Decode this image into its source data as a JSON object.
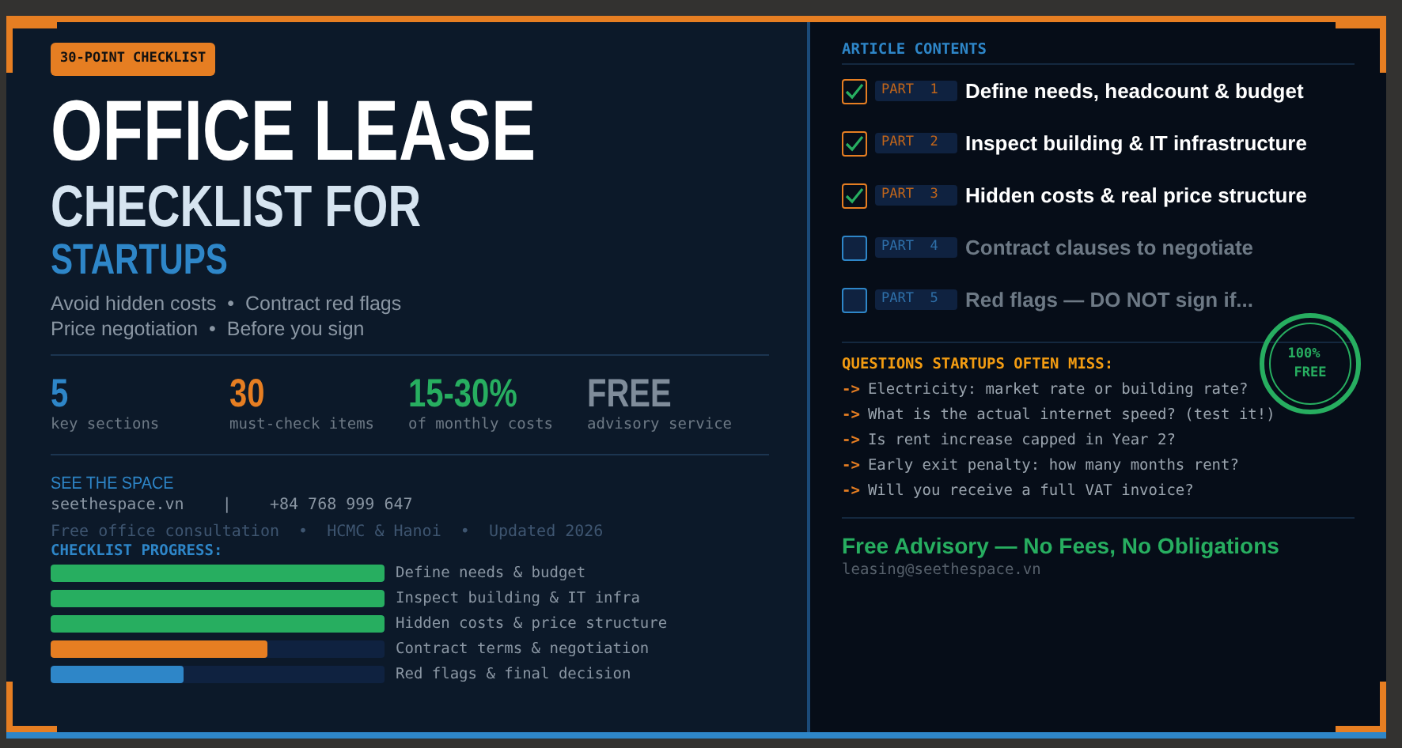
{
  "badge": "30-POINT CHECKLIST",
  "title": {
    "line1": "OFFICE LEASE",
    "line2": "CHECKLIST FOR",
    "line3": "STARTUPS"
  },
  "subtitle_lines": [
    "Avoid hidden costs  •  Contract red flags",
    "Price negotiation  •  Before you sign"
  ],
  "stats": [
    {
      "value": "5",
      "label": "key sections",
      "color": "#2e86c8"
    },
    {
      "value": "30",
      "label": "must-check items",
      "color": "#e67e22"
    },
    {
      "value": "15-30%",
      "label": "of monthly costs",
      "color": "#27ae60"
    },
    {
      "value": "FREE",
      "label": "advisory service",
      "color": "#7f8c9a"
    }
  ],
  "brand": {
    "name": "SEE THE SPACE",
    "contact": "seethespace.vn    |    +84 768 999 647",
    "note": "Free office consultation  •  HCMC & Hanoi  •  Updated 2026"
  },
  "progress": {
    "heading": "CHECKLIST PROGRESS:",
    "items": [
      {
        "label": "Define needs & budget",
        "level": 1,
        "color": "#27ae60"
      },
      {
        "label": "Inspect building & IT infra",
        "level": 1,
        "color": "#27ae60"
      },
      {
        "label": "Hidden costs & price structure",
        "level": 1,
        "color": "#27ae60"
      },
      {
        "label": "Contract terms & negotiation",
        "level": 0.65,
        "color": "#e67e22"
      },
      {
        "label": "Red flags & final decision",
        "level": 0.4,
        "color": "#2e86c8"
      }
    ]
  },
  "contents": {
    "heading": "ARTICLE CONTENTS",
    "items": [
      {
        "part": "PART 1",
        "title": "Define needs, headcount & budget",
        "checked": true
      },
      {
        "part": "PART 2",
        "title": "Inspect building & IT infrastructure",
        "checked": true
      },
      {
        "part": "PART 3",
        "title": "Hidden costs & real price structure",
        "checked": true
      },
      {
        "part": "PART 4",
        "title": "Contract clauses to negotiate",
        "checked": false
      },
      {
        "part": "PART 5",
        "title": "Red flags — DO NOT sign if...",
        "checked": false
      }
    ]
  },
  "stamp": {
    "line1": "100%",
    "line2": "FREE"
  },
  "questions": {
    "heading": "QUESTIONS STARTUPS OFTEN MISS:",
    "items": [
      {
        "arrow": "->",
        "text": "Electricity: market rate or building rate?"
      },
      {
        "arrow": "->",
        "text": "What is the actual internet speed? (test it!)"
      },
      {
        "arrow": "->",
        "text": "Is rent increase capped in Year 2?"
      },
      {
        "arrow": "->",
        "text": "Early exit penalty: how many months rent?"
      },
      {
        "arrow": "->",
        "text": "Will you receive a full VAT invoice?"
      }
    ]
  },
  "footer": {
    "headline": "Free Advisory — No Fees, No Obligations",
    "email": "leasing@seethespace.vn"
  }
}
